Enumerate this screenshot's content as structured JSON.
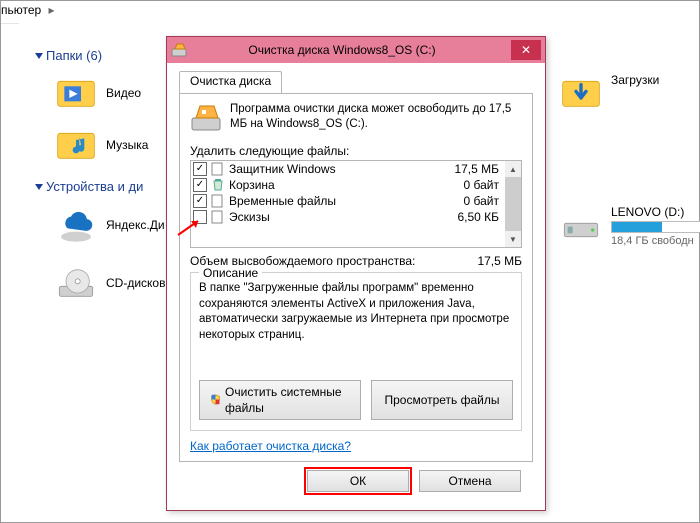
{
  "breadcrumb": {
    "segment": "пьютер",
    "chevron": "▸"
  },
  "groups": {
    "folders": {
      "title": "Папки (6)"
    },
    "devices": {
      "title": "Устройства и ди"
    }
  },
  "left_items": {
    "video": "Видео",
    "music": "Музыка",
    "yadisk": "Яндекс.Ди",
    "cddrive": "CD-дисков"
  },
  "right_items": {
    "downloads": "Загрузки",
    "lenovo": {
      "name": "LENOVO (D:)",
      "free": "18,4 ГБ свободн",
      "used_pct": 55
    }
  },
  "dialog": {
    "title": "Очистка диска Windows8_OS (C:)",
    "tab": "Очистка диска",
    "intro": "Программа очистки диска может освободить до 17,5 МБ на Windows8_OS (C:).",
    "delete_label": "Удалить следующие файлы:",
    "files": [
      {
        "checked": true,
        "name": "Защитник Windows",
        "size": "17,5 МБ"
      },
      {
        "checked": true,
        "name": "Корзина",
        "size": "0 байт"
      },
      {
        "checked": true,
        "name": "Временные файлы",
        "size": "0 байт"
      },
      {
        "checked": false,
        "name": "Эскизы",
        "size": "6,50 КБ"
      }
    ],
    "total_label": "Объем высвобождаемого пространства:",
    "total_value": "17,5 МБ",
    "desc_legend": "Описание",
    "desc_text": "В папке \"Загруженные файлы программ\" временно сохраняются элементы ActiveX и приложения Java, автоматически загружаемые из Интернета при просмотре некоторых страниц.",
    "btn_clean_system": "Очистить системные файлы",
    "btn_view_files": "Просмотреть файлы",
    "link": "Как работает очистка диска?",
    "btn_ok": "ОК",
    "btn_cancel": "Отмена"
  }
}
